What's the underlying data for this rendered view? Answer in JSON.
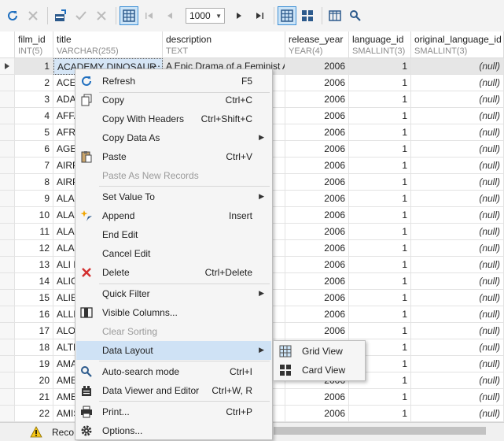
{
  "toolbar": {
    "page_size": "1000"
  },
  "columns": [
    {
      "name": "film_id",
      "type": "INT(5)"
    },
    {
      "name": "title",
      "type": "VARCHAR(255)"
    },
    {
      "name": "description",
      "type": "TEXT"
    },
    {
      "name": "release_year",
      "type": "YEAR(4)"
    },
    {
      "name": "language_id",
      "type": "SMALLINT(3)"
    },
    {
      "name": "original_language_id",
      "type": "SMALLINT(3)"
    }
  ],
  "rows": [
    {
      "id": "1",
      "title": "ACADEMY DINOSAUR",
      "desc": "A Epic Drama of a Feminist A...",
      "year": "2006",
      "lang": "1",
      "orig": "(null)"
    },
    {
      "id": "2",
      "title": "ACE",
      "desc": "...",
      "year": "2006",
      "lang": "1",
      "orig": "(null)"
    },
    {
      "id": "3",
      "title": "ADA",
      "desc": "...",
      "year": "2006",
      "lang": "1",
      "orig": "(null)"
    },
    {
      "id": "4",
      "title": "AFFA",
      "desc": "...",
      "year": "2006",
      "lang": "1",
      "orig": "(null)"
    },
    {
      "id": "5",
      "title": "AFRI",
      "desc": "...",
      "year": "2006",
      "lang": "1",
      "orig": "(null)"
    },
    {
      "id": "6",
      "title": "AGEN",
      "desc": "...",
      "year": "2006",
      "lang": "1",
      "orig": "(null)"
    },
    {
      "id": "7",
      "title": "AIRP",
      "desc": "...",
      "year": "2006",
      "lang": "1",
      "orig": "(null)"
    },
    {
      "id": "8",
      "title": "AIRP",
      "desc": "...",
      "year": "2006",
      "lang": "1",
      "orig": "(null)"
    },
    {
      "id": "9",
      "title": "ALAB",
      "desc": "...",
      "year": "2006",
      "lang": "1",
      "orig": "(null)"
    },
    {
      "id": "10",
      "title": "ALAD",
      "desc": "...",
      "year": "2006",
      "lang": "1",
      "orig": "(null)"
    },
    {
      "id": "11",
      "title": "ALAM",
      "desc": "...",
      "year": "2006",
      "lang": "1",
      "orig": "(null)"
    },
    {
      "id": "12",
      "title": "ALAS",
      "desc": "...",
      "year": "2006",
      "lang": "1",
      "orig": "(null)"
    },
    {
      "id": "13",
      "title": "ALI F",
      "desc": "...",
      "year": "2006",
      "lang": "1",
      "orig": "(null)"
    },
    {
      "id": "14",
      "title": "ALIC",
      "desc": "...",
      "year": "2006",
      "lang": "1",
      "orig": "(null)"
    },
    {
      "id": "15",
      "title": "ALIE",
      "desc": "...",
      "year": "2006",
      "lang": "1",
      "orig": "(null)"
    },
    {
      "id": "16",
      "title": "ALLE",
      "desc": "...",
      "year": "2006",
      "lang": "1",
      "orig": "(null)"
    },
    {
      "id": "17",
      "title": "ALON",
      "desc": "...",
      "year": "2006",
      "lang": "1",
      "orig": "(null)"
    },
    {
      "id": "18",
      "title": "ALTE",
      "desc": "...",
      "year": "2006",
      "lang": "1",
      "orig": "(null)"
    },
    {
      "id": "19",
      "title": "AMA",
      "desc": "...",
      "year": "2006",
      "lang": "1",
      "orig": "(null)"
    },
    {
      "id": "20",
      "title": "AMEI",
      "desc": "...",
      "year": "2006",
      "lang": "1",
      "orig": "(null)"
    },
    {
      "id": "21",
      "title": "AMEI",
      "desc": "...",
      "year": "2006",
      "lang": "1",
      "orig": "(null)"
    },
    {
      "id": "22",
      "title": "AMIS",
      "desc": "...",
      "year": "2006",
      "lang": "1",
      "orig": "(null)"
    }
  ],
  "status": {
    "text": "Reco"
  },
  "context_menu": {
    "items": [
      {
        "label": "Refresh",
        "shortcut": "F5"
      },
      {
        "label": "Copy",
        "shortcut": "Ctrl+C"
      },
      {
        "label": "Copy With Headers",
        "shortcut": "Ctrl+Shift+C"
      },
      {
        "label": "Copy Data As",
        "shortcut": ""
      },
      {
        "label": "Paste",
        "shortcut": "Ctrl+V"
      },
      {
        "label": "Paste As New Records",
        "shortcut": ""
      },
      {
        "label": "Set Value To",
        "shortcut": ""
      },
      {
        "label": "Append",
        "shortcut": "Insert"
      },
      {
        "label": "End Edit",
        "shortcut": ""
      },
      {
        "label": "Cancel Edit",
        "shortcut": ""
      },
      {
        "label": "Delete",
        "shortcut": "Ctrl+Delete"
      },
      {
        "label": "Quick Filter",
        "shortcut": ""
      },
      {
        "label": "Visible Columns...",
        "shortcut": ""
      },
      {
        "label": "Clear Sorting",
        "shortcut": ""
      },
      {
        "label": "Data Layout",
        "shortcut": ""
      },
      {
        "label": "Auto-search mode",
        "shortcut": "Ctrl+I"
      },
      {
        "label": "Data Viewer and Editor",
        "shortcut": "Ctrl+W, R"
      },
      {
        "label": "Print...",
        "shortcut": "Ctrl+P"
      },
      {
        "label": "Options...",
        "shortcut": ""
      }
    ]
  },
  "submenu": {
    "items": [
      {
        "label": "Grid View"
      },
      {
        "label": "Card View"
      }
    ]
  },
  "colors": {
    "accent": "#3d8fd6",
    "highlight": "#cfe2f5",
    "delete_red": "#d32f2f",
    "refresh_blue": "#1f6fbf"
  }
}
